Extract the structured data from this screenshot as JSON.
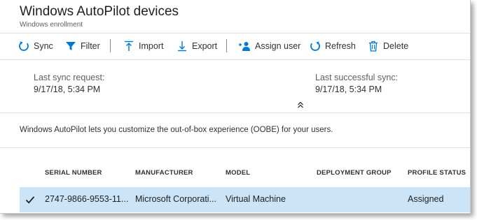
{
  "header": {
    "title": "Windows AutoPilot devices",
    "subtitle": "Windows enrollment"
  },
  "toolbar": {
    "sync": "Sync",
    "filter": "Filter",
    "import": "Import",
    "export": "Export",
    "assign_user": "Assign user",
    "refresh": "Refresh",
    "delete": "Delete"
  },
  "sync_info": {
    "last_request_label": "Last sync request:",
    "last_request_value": "9/17/18, 5:34 PM",
    "last_success_label": "Last successful sync:",
    "last_success_value": "9/17/18, 5:34 PM"
  },
  "description": "Windows AutoPilot lets you customize the out-of-box experience (OOBE) for your users.",
  "table": {
    "columns": [
      "SERIAL NUMBER",
      "MANUFACTURER",
      "MODEL",
      "DEPLOYMENT GROUP",
      "PROFILE STATUS"
    ],
    "rows": [
      {
        "selected": true,
        "serial_number": "2747-9866-9553-11...",
        "manufacturer": "Microsoft Corporati...",
        "model": "Virtual Machine",
        "deployment_group": "",
        "profile_status": "Assigned"
      }
    ]
  },
  "colors": {
    "accent": "#0078d4",
    "selected_row": "#cce4f7"
  },
  "icons": {
    "sync": "sync-icon",
    "filter": "filter-icon",
    "import": "import-icon",
    "export": "export-icon",
    "assign_user": "assign-user-icon",
    "refresh": "refresh-icon",
    "delete": "delete-icon",
    "collapse": "chevron-double-up-icon",
    "row_check": "checkmark-icon"
  }
}
